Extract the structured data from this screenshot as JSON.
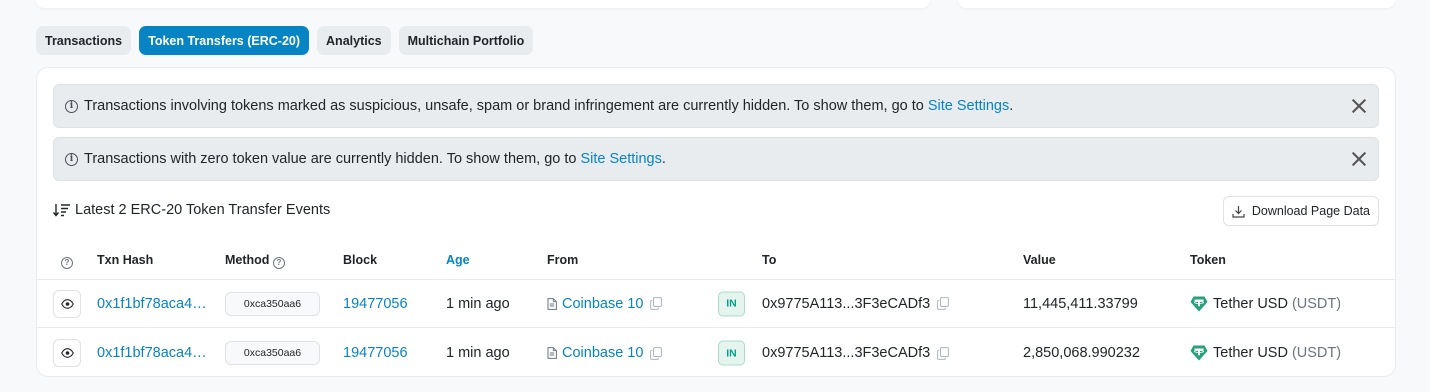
{
  "tabs": [
    {
      "label": "Transactions",
      "active": false
    },
    {
      "label": "Token Transfers (ERC-20)",
      "active": true
    },
    {
      "label": "Analytics",
      "active": false
    },
    {
      "label": "Multichain Portfolio",
      "active": false
    }
  ],
  "alerts": [
    {
      "text": "Transactions involving tokens marked as suspicious, unsafe, spam or brand infringement are currently hidden. To show them, go to",
      "link": "Site Settings",
      "end": "."
    },
    {
      "text": "Transactions with zero token value are currently hidden. To show them, go to",
      "link": "Site Settings",
      "end": "."
    }
  ],
  "events_title": "Latest 2 ERC-20 Token Transfer Events",
  "download_label": "Download Page Data",
  "columns": {
    "txn_hash": "Txn Hash",
    "method": "Method",
    "block": "Block",
    "age": "Age",
    "from": "From",
    "to": "To",
    "value": "Value",
    "token": "Token"
  },
  "rows": [
    {
      "txn_hash": "0x1f1bf78aca4…",
      "method": "0xca350aa6",
      "block": "19477056",
      "age": "1 min ago",
      "from": "Coinbase 10",
      "direction": "IN",
      "to": "0x9775A113...3F3eCADf3",
      "value": "11,445,411.33799",
      "token_name": "Tether USD",
      "token_symbol": "(USDT)"
    },
    {
      "txn_hash": "0x1f1bf78aca4…",
      "method": "0xca350aa6",
      "block": "19477056",
      "age": "1 min ago",
      "from": "Coinbase 10",
      "direction": "IN",
      "to": "0x9775A113...3F3eCADf3",
      "value": "2,850,068.990232",
      "token_name": "Tether USD",
      "token_symbol": "(USDT)"
    }
  ],
  "colors": {
    "accent": "#0784c3",
    "in_badge": "#00a186",
    "tether": "#26a17b"
  }
}
